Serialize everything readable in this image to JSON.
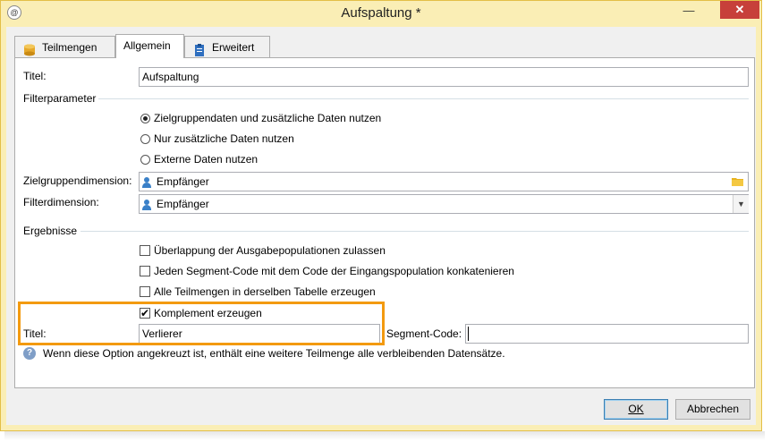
{
  "window": {
    "title": "Aufspaltung *"
  },
  "tabs": [
    {
      "label": "Teilmengen"
    },
    {
      "label": "Allgemein"
    },
    {
      "label": "Erweitert"
    }
  ],
  "general": {
    "title_label": "Titel:",
    "title_value": "Aufspaltung",
    "filter_section": "Filterparameter",
    "radio_options": [
      {
        "label": "Zielgruppendaten und zusätzliche Daten nutzen",
        "selected": true
      },
      {
        "label": "Nur zusätzliche Daten nutzen",
        "selected": false
      },
      {
        "label": "Externe Daten nutzen",
        "selected": false
      }
    ],
    "target_dimension_label": "Zielgruppendimension:",
    "target_dimension_value": "Empfänger",
    "filter_dimension_label": "Filterdimension:",
    "filter_dimension_value": "Empfänger",
    "results_section": "Ergebnisse",
    "checkboxes": [
      {
        "label": "Überlappung der Ausgabepopulationen zulassen",
        "checked": false
      },
      {
        "label": "Jeden Segment-Code mit dem Code der Eingangspopulation konkatenieren",
        "checked": false
      },
      {
        "label": "Alle Teilmengen in derselben Tabelle erzeugen",
        "checked": false
      },
      {
        "label": "Komplement erzeugen",
        "checked": true
      }
    ],
    "complement_title_label": "Titel:",
    "complement_title_value": "Verlierer",
    "segment_code_label": "Segment-Code:",
    "segment_code_value": "",
    "help_text": "Wenn diese Option angekreuzt ist, enthält eine weitere Teilmenge alle verbleibenden Datensätze."
  },
  "buttons": {
    "ok": "OK",
    "cancel": "Abbrechen"
  },
  "colors": {
    "title_bar": "#faeeb5",
    "highlight": "#f39a10",
    "close_button": "#c7403a"
  }
}
